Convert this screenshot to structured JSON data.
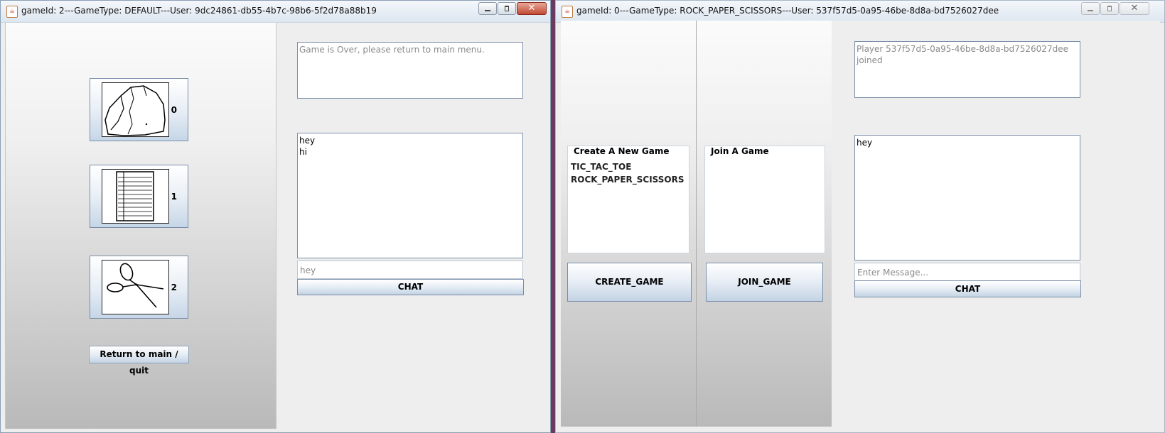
{
  "left_window": {
    "title": "gameId: 2---GameType: DEFAULT---User: 9dc24861-db55-4b7c-98b6-5f2d78a88b19",
    "controls": {
      "minimize_icon": "minimize-icon",
      "maximize_icon": "maximize-icon",
      "close_label": "✕"
    },
    "choices": [
      {
        "icon": "rock-icon",
        "number": "0"
      },
      {
        "icon": "paper-icon",
        "number": "1"
      },
      {
        "icon": "scissors-icon",
        "number": "2"
      }
    ],
    "quit_label": "Return to main / quit",
    "status_text": "Game is Over, please return to main menu.",
    "chat_log": [
      "hey",
      "hi"
    ],
    "chat_input_value": "hey",
    "chat_button_label": "CHAT"
  },
  "right_window": {
    "title": "gameId: 0---GameType: ROCK_PAPER_SCISSORS---User: 537f57d5-0a95-46be-8d8a-bd7526027dee",
    "controls": {
      "close_label": "✕"
    },
    "create_group_title": "Create A New Game",
    "game_types": [
      "TIC_TAC_TOE",
      "ROCK_PAPER_SCISSORS"
    ],
    "join_group_title": "Join A Game",
    "create_button_label": "CREATE_GAME",
    "join_button_label": "JOIN_GAME",
    "status_text": "Player 537f57d5-0a95-46be-8d8a-bd7526027dee joined",
    "chat_log": [
      "hey"
    ],
    "chat_input_placeholder": "Enter Message...",
    "chat_button_label": "CHAT"
  },
  "colors": {
    "desktop": "#6b3a5e",
    "button_edge": "#7a8ea8",
    "panel_gray": "#eeeeee"
  }
}
